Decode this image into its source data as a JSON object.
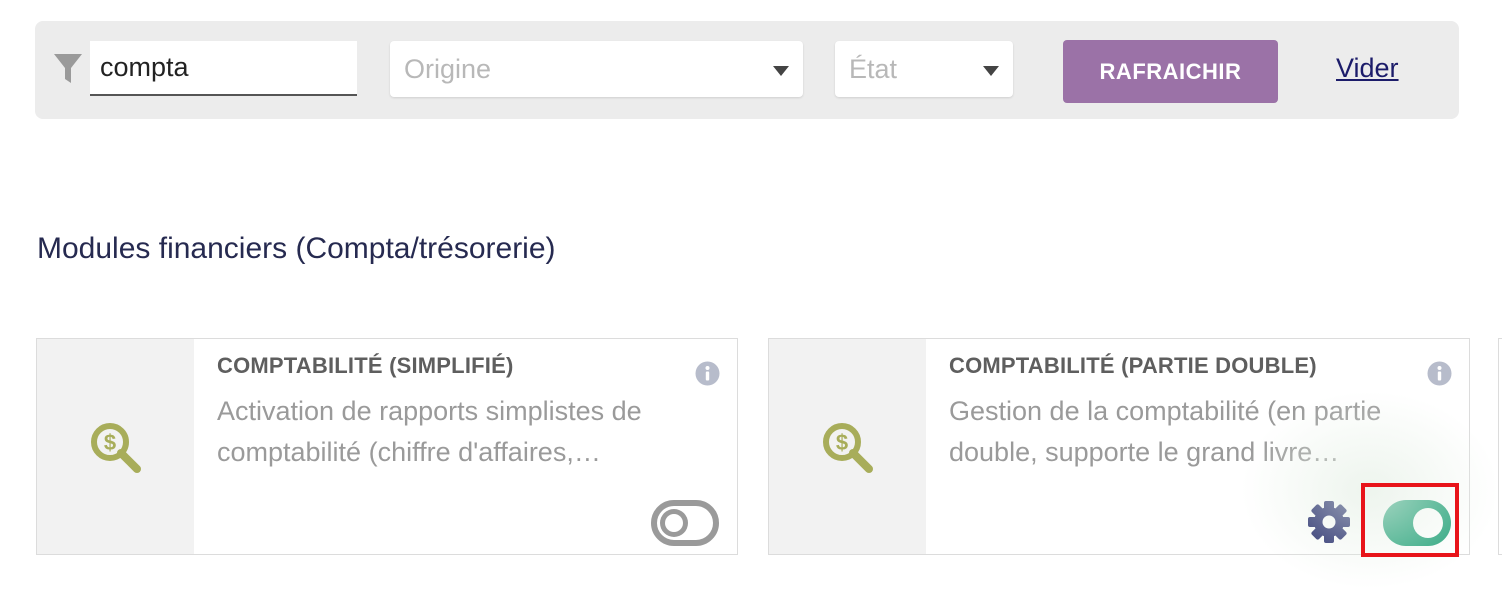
{
  "filter": {
    "search_value": "compta",
    "origin_placeholder": "Origine",
    "state_placeholder": "État",
    "refresh_label": "RAFRAICHIR",
    "clear_label": "Vider"
  },
  "section": {
    "title": "Modules financiers (Compta/trésorerie)"
  },
  "modules": [
    {
      "title": "COMPTABILITÉ (SIMPLIFIÉ)",
      "description": "Activation de rapports simplistes de comptabilité (chiffre d'affaires,…",
      "enabled": false
    },
    {
      "title": "COMPTABILITÉ (PARTIE DOUBLE)",
      "description": "Gestion de la comptabilité (en partie double, supporte le grand livre…",
      "enabled": true
    }
  ],
  "colors": {
    "accent": "#9b72a7",
    "toggle_on": "#2aa57e",
    "toggle_off": "#9a9a9a",
    "module_icon": "#a8ad5a",
    "highlight": "#e8141a"
  }
}
